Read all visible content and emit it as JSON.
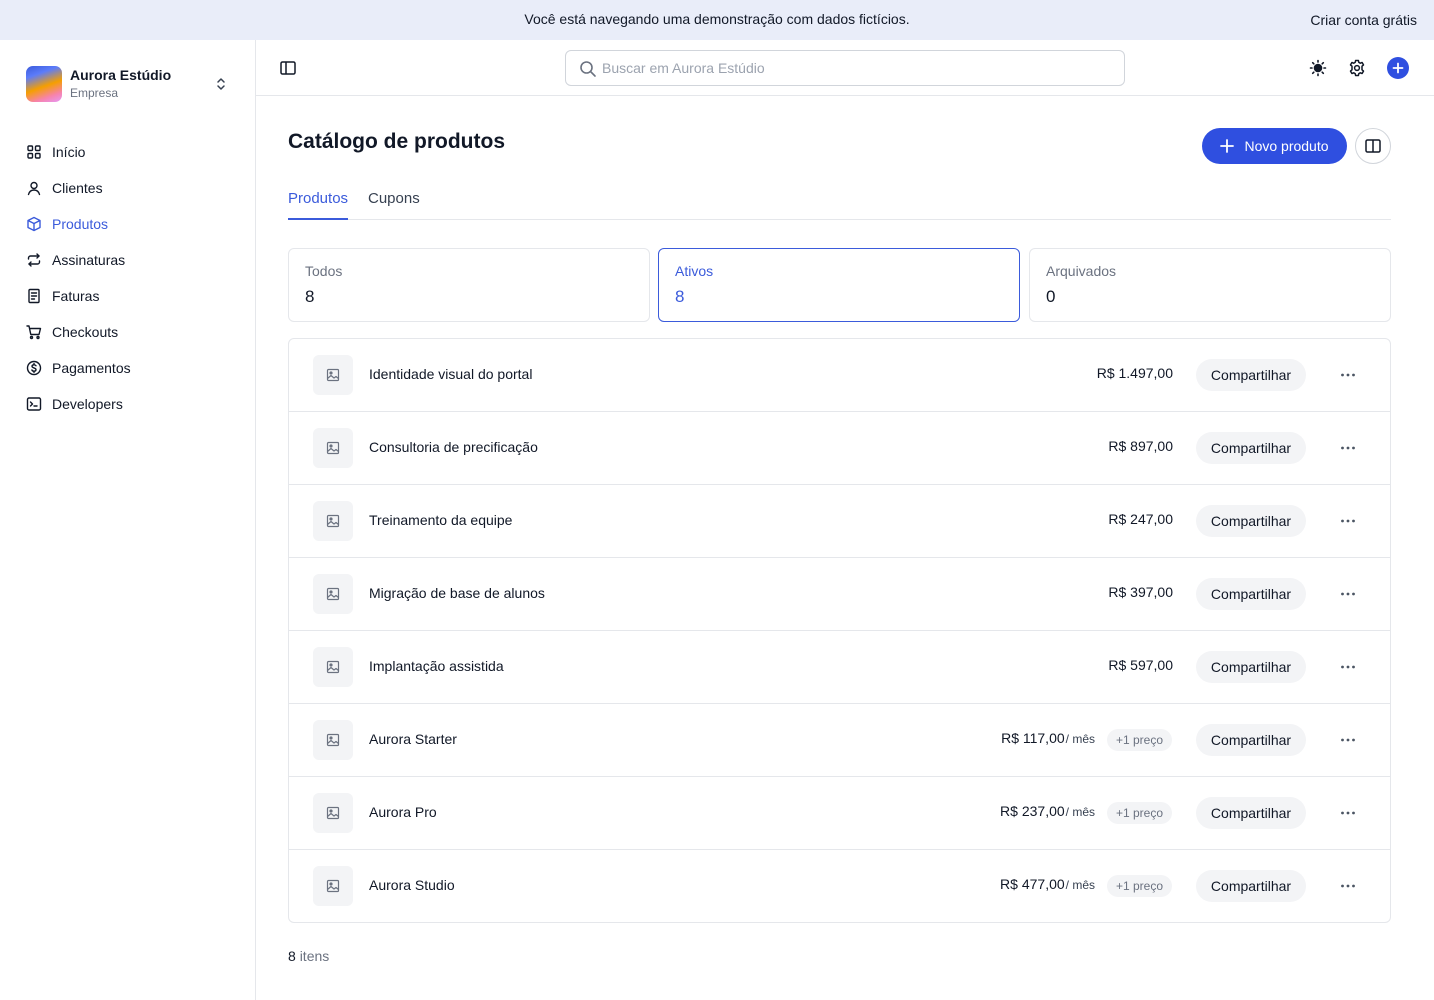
{
  "banner": {
    "text": "Você está navegando uma demonstração com dados fictícios.",
    "cta": "Criar conta grátis"
  },
  "org": {
    "name": "Aurora Estúdio",
    "type": "Empresa"
  },
  "sidebar": {
    "items": [
      {
        "label": "Início",
        "icon": "grid-icon"
      },
      {
        "label": "Clientes",
        "icon": "user-icon"
      },
      {
        "label": "Produtos",
        "icon": "box-icon",
        "active": true
      },
      {
        "label": "Assinaturas",
        "icon": "repeat-icon"
      },
      {
        "label": "Faturas",
        "icon": "receipt-icon"
      },
      {
        "label": "Checkouts",
        "icon": "cart-icon"
      },
      {
        "label": "Pagamentos",
        "icon": "dollar-circle-icon"
      },
      {
        "label": "Developers",
        "icon": "terminal-icon"
      }
    ]
  },
  "search": {
    "placeholder": "Buscar em Aurora Estúdio",
    "value": ""
  },
  "page": {
    "title": "Catálogo de produtos",
    "new_button": "Novo produto"
  },
  "tabs": [
    {
      "label": "Produtos",
      "active": true
    },
    {
      "label": "Cupons"
    }
  ],
  "stats": [
    {
      "label": "Todos",
      "value": "8"
    },
    {
      "label": "Ativos",
      "value": "8",
      "active": true
    },
    {
      "label": "Arquivados",
      "value": "0"
    }
  ],
  "products": [
    {
      "name": "Identidade visual do portal",
      "price": "R$ 1.497,00",
      "period": "",
      "extra": ""
    },
    {
      "name": "Consultoria de precificação",
      "price": "R$ 897,00",
      "period": "",
      "extra": ""
    },
    {
      "name": "Treinamento da equipe",
      "price": "R$ 247,00",
      "period": "",
      "extra": ""
    },
    {
      "name": "Migração de base de alunos",
      "price": "R$ 397,00",
      "period": "",
      "extra": ""
    },
    {
      "name": "Implantação assistida",
      "price": "R$ 597,00",
      "period": "",
      "extra": ""
    },
    {
      "name": "Aurora Starter",
      "price": "R$ 117,00",
      "period": "/ mês",
      "extra": "+1 preço"
    },
    {
      "name": "Aurora Pro",
      "price": "R$ 237,00",
      "period": "/ mês",
      "extra": "+1 preço"
    },
    {
      "name": "Aurora Studio",
      "price": "R$ 477,00",
      "period": "/ mês",
      "extra": "+1 preço"
    }
  ],
  "share_label": "Compartilhar",
  "footer": {
    "count": "8",
    "count_label": "itens"
  },
  "colors": {
    "accent": "#2f4fe0",
    "banner_bg": "#e9edf9",
    "border": "#e5e7eb"
  }
}
